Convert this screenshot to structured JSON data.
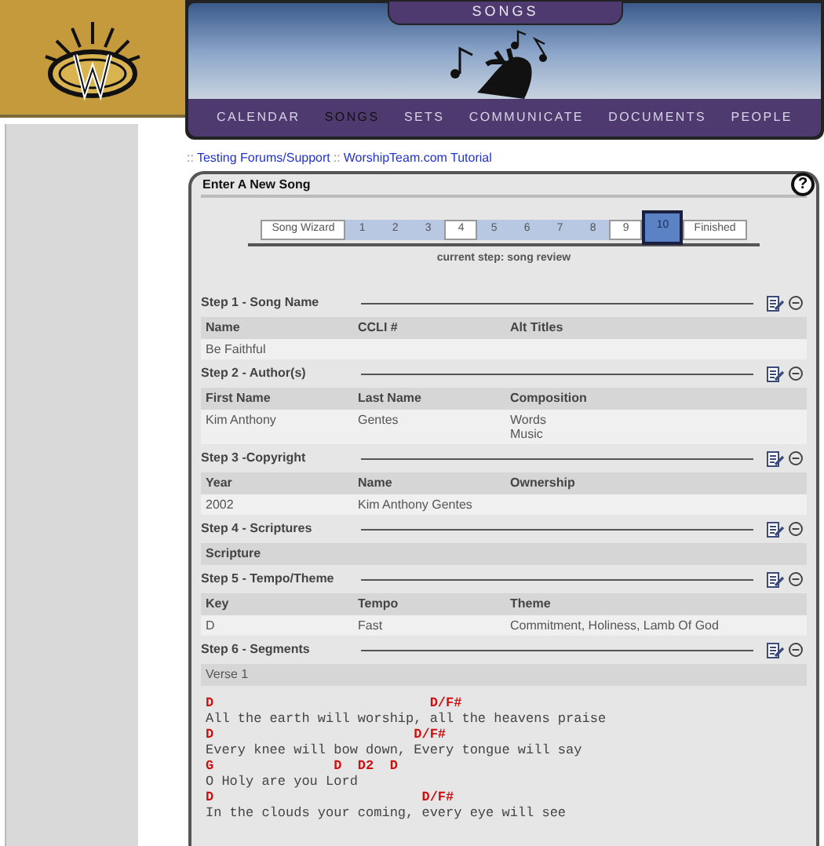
{
  "header": {
    "section_tab": "SONGS",
    "nav": [
      {
        "label": "CALENDAR",
        "selected": false
      },
      {
        "label": "SONGS",
        "selected": true
      },
      {
        "label": "SETS",
        "selected": false
      },
      {
        "label": "COMMUNICATE",
        "selected": false
      },
      {
        "label": "DOCUMENTS",
        "selected": false
      },
      {
        "label": "PEOPLE",
        "selected": false
      }
    ]
  },
  "links": [
    {
      "prefix": "::",
      "label": "Testing Forums/Support"
    },
    {
      "prefix": "::",
      "label": "WorshipTeam.com Tutorial"
    }
  ],
  "panel": {
    "title": "Enter A New Song",
    "help": "?",
    "wizard": {
      "steps": [
        {
          "label": "Song Wizard",
          "kind": "label",
          "done": false,
          "selected": false
        },
        {
          "label": "1",
          "kind": "step",
          "done": true,
          "selected": false
        },
        {
          "label": "2",
          "kind": "step",
          "done": true,
          "selected": false
        },
        {
          "label": "3",
          "kind": "step",
          "done": true,
          "selected": false
        },
        {
          "label": "4",
          "kind": "step",
          "done": false,
          "selected": false
        },
        {
          "label": "5",
          "kind": "step",
          "done": true,
          "selected": false
        },
        {
          "label": "6",
          "kind": "step",
          "done": true,
          "selected": false
        },
        {
          "label": "7",
          "kind": "step",
          "done": true,
          "selected": false
        },
        {
          "label": "8",
          "kind": "step",
          "done": true,
          "selected": false
        },
        {
          "label": "9",
          "kind": "step",
          "done": false,
          "selected": false
        },
        {
          "label": "10",
          "kind": "step",
          "done": true,
          "selected": true
        },
        {
          "label": "Finished",
          "kind": "label",
          "done": false,
          "selected": false
        }
      ],
      "caption": "current step: song review"
    },
    "sections": [
      {
        "title": "Step 1 - Song Name",
        "kind": "table",
        "columns": [
          "Name",
          "CCLI #",
          "Alt Titles"
        ],
        "rows": [
          [
            "Be Faithful",
            "",
            ""
          ]
        ]
      },
      {
        "title": "Step 2 - Author(s)",
        "kind": "table",
        "columns": [
          "First Name",
          "Last Name",
          "Composition"
        ],
        "rows": [
          [
            "Kim Anthony",
            "Gentes",
            "Words\nMusic"
          ]
        ]
      },
      {
        "title": "Step 3 -Copyright",
        "kind": "table",
        "columns": [
          "Year",
          "Name",
          "Ownership"
        ],
        "rows": [
          [
            "2002",
            "Kim Anthony Gentes",
            ""
          ]
        ]
      },
      {
        "title": "Step 4 - Scriptures",
        "kind": "table",
        "columns": [
          "Scripture"
        ]
      },
      {
        "title": "Step 5 - Tempo/Theme",
        "kind": "table",
        "columns": [
          "Key",
          "Tempo",
          "Theme"
        ],
        "rows": [
          [
            "D",
            "Fast",
            "Commitment, Holiness, Lamb Of God"
          ]
        ]
      },
      {
        "title": "Step 6 - Segments",
        "kind": "segments",
        "segment": {
          "label": "Verse 1",
          "lines": [
            {
              "kind": "chord",
              "text": "D                           D/F#"
            },
            {
              "kind": "lyric",
              "text": "All the earth will worship, all the heavens praise"
            },
            {
              "kind": "chord",
              "text": "D                         D/F#"
            },
            {
              "kind": "lyric",
              "text": "Every knee will bow down, Every tongue will say"
            },
            {
              "kind": "chord",
              "text": "G               D  D2  D"
            },
            {
              "kind": "lyric",
              "text": "O Holy are you Lord"
            },
            {
              "kind": "chord",
              "text": "D                          D/F#"
            },
            {
              "kind": "lyric",
              "text": "In the clouds your coming, every eye will see"
            }
          ]
        }
      }
    ]
  }
}
